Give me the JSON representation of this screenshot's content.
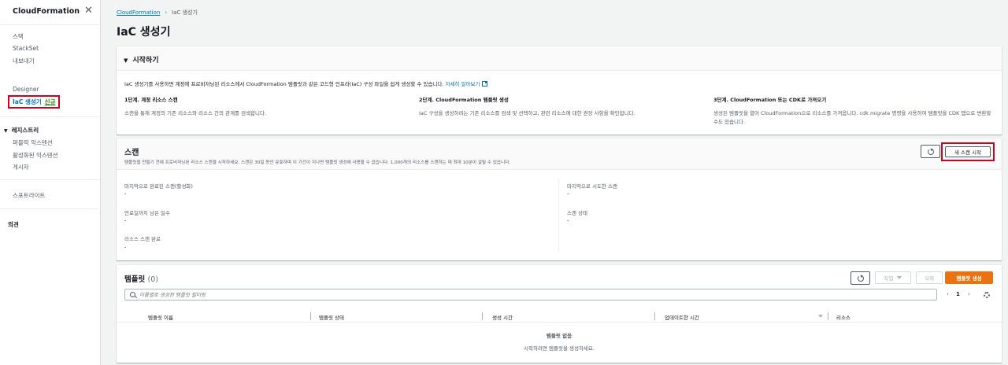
{
  "sidebar": {
    "title": "CloudFormation",
    "close_icon": "close-icon",
    "items_top": [
      "스택",
      "StackSet",
      "내보내기"
    ],
    "designer": "Designer",
    "active_item": "IaC 생성기",
    "active_badge": "신규",
    "registry_section": "레지스트리",
    "registry_items": [
      "퍼블릭 익스텐션",
      "활성화된 익스텐션",
      "게시자"
    ],
    "spotlight": "스포트라이트",
    "feedback": "의견"
  },
  "breadcrumb": {
    "root": "CloudFormation",
    "current": "IaC 생성기"
  },
  "page": {
    "title": "IaC 생성기"
  },
  "getting_started": {
    "header": "시작하기",
    "description": "IaC 생성기를 사용하면 계정에 프로비저닝된 리소스에서 CloudFormation 템플릿과 같은 코드형 인프라(IaC) 구성 파일을 쉽게 생성할 수 있습니다.",
    "learn_more": "자세히 알아보기",
    "steps": [
      {
        "title": "1단계. 계정 리소스 스캔",
        "desc": "스캔을 통해 계정의 기존 리소스와 리소스 간의 관계를 검색합니다."
      },
      {
        "title": "2단계. CloudFormation 템플릿 생성",
        "desc": "IaC 구성을 생성하려는 기존 리소스를 검색 및 선택하고, 관련 리소스에 대한 권장 사항을 확인합니다."
      },
      {
        "title": "3단계. CloudFormation 또는 CDK로 가져오기",
        "desc": "생성된 템플릿을 열어 CloudFormation으로 리소스를 가져옵니다. cdk migrate 명령을 사용하여 템플릿을 CDK 앱으로 변환할 수도 있습니다."
      }
    ]
  },
  "scan": {
    "title": "스캔",
    "description": "템플릿을 만들기 전에 프로비저닝된 리소스 스캔을 시작하세요. 스캔은 30일 동안 유효하며 이 기간이 지나면 템플릿 생성에 사용할 수 없습니다. 1,000개의 리소스를 스캔하는 데 최대 10분이 걸릴 수 있습니다.",
    "new_scan_label": "새 스캔 시작",
    "left": [
      {
        "label": "마지막으로 완료된 스캔(활성화)",
        "value": "-"
      },
      {
        "label": "만료일까지 남은 일수",
        "value": "-"
      },
      {
        "label": "리소스 스캔 완료",
        "value": "-"
      }
    ],
    "right": [
      {
        "label": "마지막으로 시도한 스캔",
        "value": "-"
      },
      {
        "label": "스캔 상태",
        "value": "-"
      }
    ]
  },
  "templates": {
    "title": "템플릿",
    "count": "(0)",
    "actions_label": "작업",
    "delete_label": "삭제",
    "create_label": "템플릿 생성",
    "search_placeholder": "이름별로 생성된 템플릿 필터링",
    "page_number": "1",
    "columns": [
      "템플릿 이름",
      "템플릿 상태",
      "생성 시간",
      "업데이트한 시간",
      "리소스"
    ],
    "empty_title": "템플릿 없음",
    "empty_desc": "시작하려면 템플릿을 생성하세요."
  },
  "colors": {
    "link": "#0073bb",
    "primary": "#ec7211",
    "highlight": "#d0021b",
    "new_badge": "#1d8102"
  }
}
